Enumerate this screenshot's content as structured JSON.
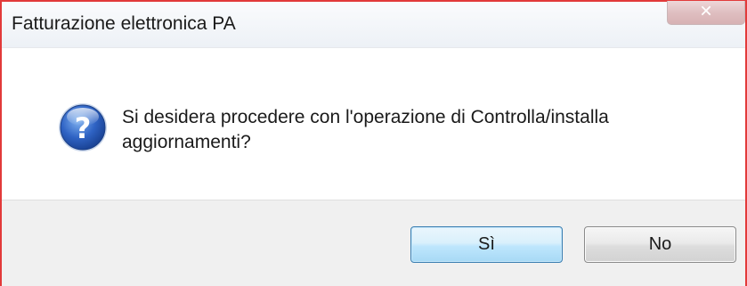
{
  "window": {
    "title": "Fatturazione elettronica PA",
    "close_icon": "close-icon"
  },
  "message": {
    "icon": "question-icon",
    "text": "Si desidera procedere con l'operazione di Controlla/installa aggiornamenti?"
  },
  "buttons": {
    "yes_label": "Sì",
    "no_label": "No"
  },
  "colors": {
    "frame_border": "#e23a3a",
    "icon_blue": "#2a5db0",
    "default_button_border": "#3c7fb1"
  }
}
